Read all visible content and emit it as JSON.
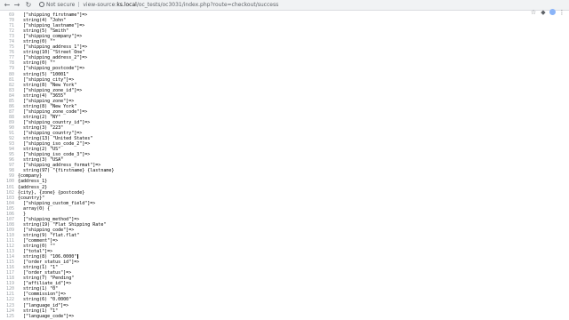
{
  "browser": {
    "security_label": "Not secure",
    "url_scheme": "view-source:",
    "url_host": "ks.local",
    "url_path": "/oc_tests/oc3031/index.php?route=checkout/success"
  },
  "source": {
    "lines": [
      {
        "n": "69",
        "text": "  [\"shipping_firstname\"]=>"
      },
      {
        "n": "70",
        "text": "  string(4) \"John\""
      },
      {
        "n": "71",
        "text": "  [\"shipping_lastname\"]=>"
      },
      {
        "n": "72",
        "text": "  string(5) \"Smith\""
      },
      {
        "n": "73",
        "text": "  [\"shipping_company\"]=>"
      },
      {
        "n": "74",
        "text": "  string(0) \"\""
      },
      {
        "n": "75",
        "text": "  [\"shipping_address_1\"]=>"
      },
      {
        "n": "76",
        "text": "  string(10) \"Street One\""
      },
      {
        "n": "77",
        "text": "  [\"shipping_address_2\"]=>"
      },
      {
        "n": "78",
        "text": "  string(0) \"\""
      },
      {
        "n": "79",
        "text": "  [\"shipping_postcode\"]=>"
      },
      {
        "n": "80",
        "text": "  string(5) \"10001\""
      },
      {
        "n": "81",
        "text": "  [\"shipping_city\"]=>"
      },
      {
        "n": "82",
        "text": "  string(8) \"New York\""
      },
      {
        "n": "83",
        "text": "  [\"shipping_zone_id\"]=>"
      },
      {
        "n": "84",
        "text": "  string(4) \"3655\""
      },
      {
        "n": "85",
        "text": "  [\"shipping_zone\"]=>"
      },
      {
        "n": "86",
        "text": "  string(8) \"New York\""
      },
      {
        "n": "87",
        "text": "  [\"shipping_zone_code\"]=>"
      },
      {
        "n": "88",
        "text": "  string(2) \"NY\""
      },
      {
        "n": "89",
        "text": "  [\"shipping_country_id\"]=>"
      },
      {
        "n": "90",
        "text": "  string(3) \"223\""
      },
      {
        "n": "91",
        "text": "  [\"shipping_country\"]=>"
      },
      {
        "n": "92",
        "text": "  string(13) \"United States\""
      },
      {
        "n": "93",
        "text": "  [\"shipping_iso_code_2\"]=>"
      },
      {
        "n": "94",
        "text": "  string(2) \"US\""
      },
      {
        "n": "95",
        "text": "  [\"shipping_iso_code_3\"]=>"
      },
      {
        "n": "96",
        "text": "  string(3) \"USA\""
      },
      {
        "n": "97",
        "text": "  [\"shipping_address_format\"]=>"
      },
      {
        "n": "98",
        "text": "  string(97) \"{firstname} {lastname}"
      },
      {
        "n": "99",
        "text": "{company}"
      },
      {
        "n": "100",
        "text": "{address_1}"
      },
      {
        "n": "101",
        "text": "{address_2}"
      },
      {
        "n": "102",
        "text": "{city}, {zone} {postcode}"
      },
      {
        "n": "103",
        "text": "{country}\""
      },
      {
        "n": "104",
        "text": "  [\"shipping_custom_field\"]=>"
      },
      {
        "n": "105",
        "text": "  array(0) {"
      },
      {
        "n": "106",
        "text": "  }"
      },
      {
        "n": "107",
        "text": "  [\"shipping_method\"]=>"
      },
      {
        "n": "108",
        "text": "  string(19) \"Flat Shipping Rate\""
      },
      {
        "n": "109",
        "text": "  [\"shipping_code\"]=>"
      },
      {
        "n": "110",
        "text": "  string(9) \"flat.flat\""
      },
      {
        "n": "111",
        "text": "  [\"comment\"]=>"
      },
      {
        "n": "112",
        "text": "  string(0) \"\""
      },
      {
        "n": "113",
        "text": "  [\"total\"]=>"
      },
      {
        "n": "114",
        "text": "  string(8) \"106.0000\"",
        "caret": true
      },
      {
        "n": "115",
        "text": "  [\"order_status_id\"]=>"
      },
      {
        "n": "116",
        "text": "  string(1) \"1\""
      },
      {
        "n": "117",
        "text": "  [\"order_status\"]=>"
      },
      {
        "n": "118",
        "text": "  string(7) \"Pending\""
      },
      {
        "n": "119",
        "text": "  [\"affiliate_id\"]=>"
      },
      {
        "n": "120",
        "text": "  string(1) \"0\""
      },
      {
        "n": "121",
        "text": "  [\"commission\"]=>"
      },
      {
        "n": "122",
        "text": "  string(6) \"0.0000\""
      },
      {
        "n": "123",
        "text": "  [\"language_id\"]=>"
      },
      {
        "n": "124",
        "text": "  string(1) \"1\""
      },
      {
        "n": "125",
        "text": "  [\"language_code\"]=>"
      }
    ]
  }
}
